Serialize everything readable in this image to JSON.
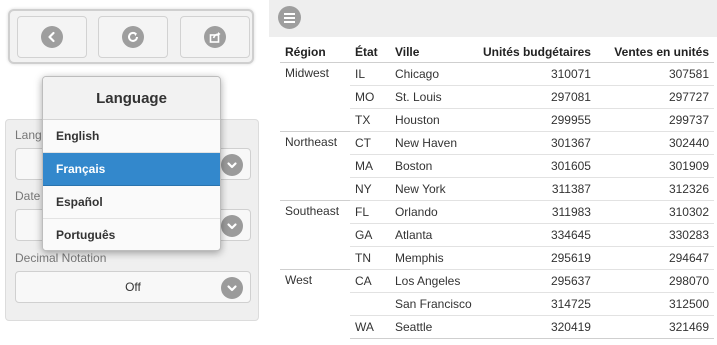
{
  "toolbar": {
    "buttons": [
      {
        "name": "back-button",
        "icon": "chevron-left-icon"
      },
      {
        "name": "refresh-button",
        "icon": "refresh-icon"
      },
      {
        "name": "share-button",
        "icon": "share-icon"
      }
    ]
  },
  "settings": {
    "language_label": "Language",
    "date_label": "Date",
    "decimal_label": "Decimal Notation",
    "decimal_value": "Off"
  },
  "language_popup": {
    "title": "Language",
    "options": [
      "English",
      "Français",
      "Español",
      "Português"
    ],
    "selected": "Français"
  },
  "table": {
    "headers": [
      "Région",
      "État",
      "Ville",
      "Unités budgétaires",
      "Ventes en unités"
    ],
    "groups": [
      {
        "region": "Midwest",
        "rows": [
          {
            "state": "IL",
            "city": "Chicago",
            "budget": "310071",
            "sales": "307581"
          },
          {
            "state": "MO",
            "city": "St. Louis",
            "budget": "297081",
            "sales": "297727"
          },
          {
            "state": "TX",
            "city": "Houston",
            "budget": "299955",
            "sales": "299737"
          }
        ]
      },
      {
        "region": "Northeast",
        "rows": [
          {
            "state": "CT",
            "city": "New Haven",
            "budget": "301367",
            "sales": "302440"
          },
          {
            "state": "MA",
            "city": "Boston",
            "budget": "301605",
            "sales": "301909"
          },
          {
            "state": "NY",
            "city": "New York",
            "budget": "311387",
            "sales": "312326"
          }
        ]
      },
      {
        "region": "Southeast",
        "rows": [
          {
            "state": "FL",
            "city": "Orlando",
            "budget": "311983",
            "sales": "310302"
          },
          {
            "state": "GA",
            "city": "Atlanta",
            "budget": "334645",
            "sales": "330283"
          },
          {
            "state": "TN",
            "city": "Memphis",
            "budget": "295619",
            "sales": "294647"
          }
        ]
      },
      {
        "region": "West",
        "rows": [
          {
            "state": "CA",
            "city": "Los Angeles",
            "budget": "295637",
            "sales": "298070"
          },
          {
            "state": "",
            "city": "San Francisco",
            "budget": "314725",
            "sales": "312500"
          },
          {
            "state": "WA",
            "city": "Seattle",
            "budget": "320419",
            "sales": "321469"
          }
        ]
      }
    ]
  },
  "colors": {
    "accent": "#3388cc",
    "icon_gray": "#9e9e9e",
    "panel_bg": "#efefef"
  }
}
